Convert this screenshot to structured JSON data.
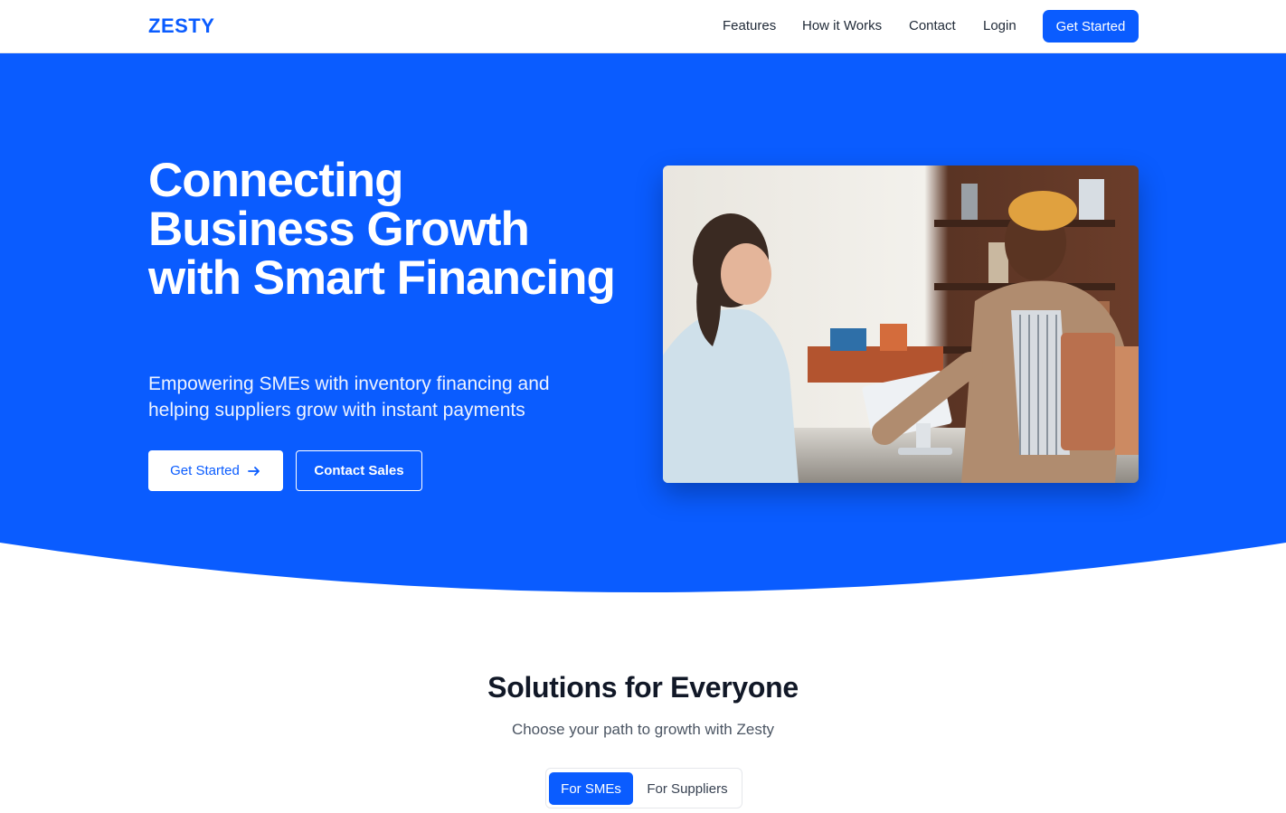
{
  "header": {
    "logo": "ZESTY",
    "nav": [
      "Features",
      "How it Works",
      "Contact",
      "Login"
    ],
    "cta": "Get Started"
  },
  "hero": {
    "title": "Connecting Business Growth with Smart Financing",
    "subtitle": "Empowering SMEs with inventory financing and helping suppliers grow with instant payments",
    "primary_button": "Get Started",
    "secondary_button": "Contact Sales",
    "image_icon": "photo-shop-counter"
  },
  "solutions": {
    "title": "Solutions for Everyone",
    "subtitle": "Choose your path to growth with Zesty",
    "tabs": [
      "For SMEs",
      "For Suppliers"
    ],
    "active_tab": "For SMEs"
  },
  "colors": {
    "brand": "#0a5cff",
    "text_dark": "#111827",
    "text_muted": "#4b5563"
  }
}
